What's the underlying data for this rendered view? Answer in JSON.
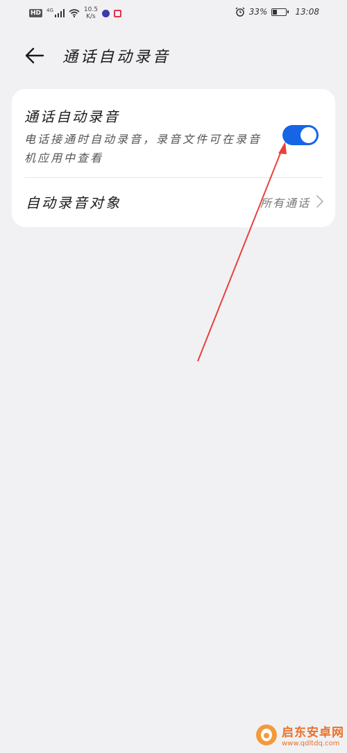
{
  "status_bar": {
    "hd": "HD",
    "network_type": "4G",
    "speed_value": "10.5",
    "speed_unit": "K/s",
    "battery_percent": "33%",
    "battery_level": 0.33,
    "time": "13:08"
  },
  "header": {
    "title": "通话自动录音"
  },
  "settings": {
    "auto_record": {
      "title": "通话自动录音",
      "description": "电话接通时自动录音，录音文件可在录音机应用中查看",
      "enabled": true
    },
    "record_target": {
      "label": "自动录音对象",
      "value": "所有通话"
    }
  },
  "colors": {
    "accent": "#1565e6",
    "annotation": "#e8403a",
    "background": "#f1f1f3"
  },
  "watermark": {
    "name": "启东安卓网",
    "url": "www.qdltdq.com"
  }
}
